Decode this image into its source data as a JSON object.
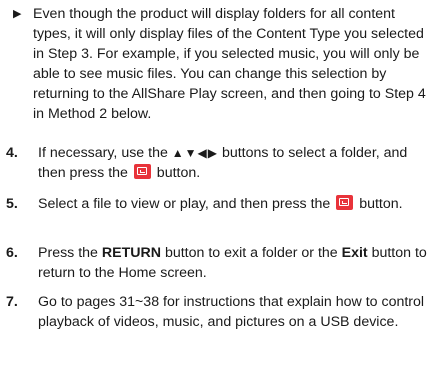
{
  "note": {
    "bullet": "▶",
    "text": "Even though the product will display folders for all content types, it will only display files of the Content Type you selected in Step 3. For example, if you selected music, you will only be able to see music files. You can change this selection by returning to the AllShare Play screen, and then going to Step 4 in Method 2 below."
  },
  "steps": [
    {
      "number": "4.",
      "text_before": "If necessary, use the ",
      "arrows": "▲▼◀▶",
      "text_middle": " buttons to select a folder, and then press the ",
      "icon": "enter-icon",
      "text_after": " button."
    },
    {
      "number": "5.",
      "text_before": "Select a file to view or play, and then press the ",
      "icon": "enter-icon",
      "text_after": " button."
    },
    {
      "number": "6.",
      "text_before": "Press the ",
      "bold1": "RETURN",
      "text_middle": " button to exit a folder or the ",
      "bold2": "Exit",
      "text_after": " button to return to the Home screen."
    },
    {
      "number": "7.",
      "text": "Go to pages 31~38 for instructions that explain how to control playback of videos, music, and pictures on a USB device."
    }
  ],
  "colors": {
    "text": "#1a1a1a",
    "enter_icon_bg": "#e8333a"
  }
}
